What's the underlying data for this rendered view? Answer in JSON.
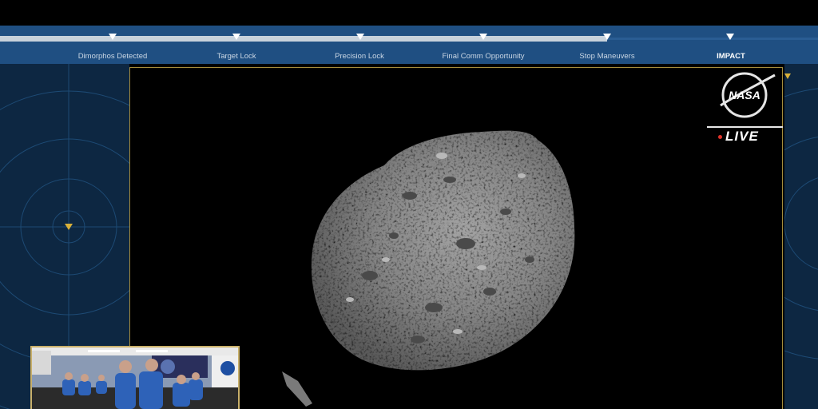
{
  "milestones": [
    {
      "label": "Dimorphos Detected"
    },
    {
      "label": "Target Lock"
    },
    {
      "label": "Precision Lock"
    },
    {
      "label": "Final Comm Opportunity"
    },
    {
      "label": "Stop Maneuvers"
    },
    {
      "label": "IMPACT"
    }
  ],
  "broadcast": {
    "logo_text": "NASA",
    "live_label": "LIVE"
  },
  "colors": {
    "panel_blue": "#1f4f82",
    "background_navy": "#0d2742",
    "frame_gold": "#a58d3c",
    "live_red": "#e0332a"
  }
}
